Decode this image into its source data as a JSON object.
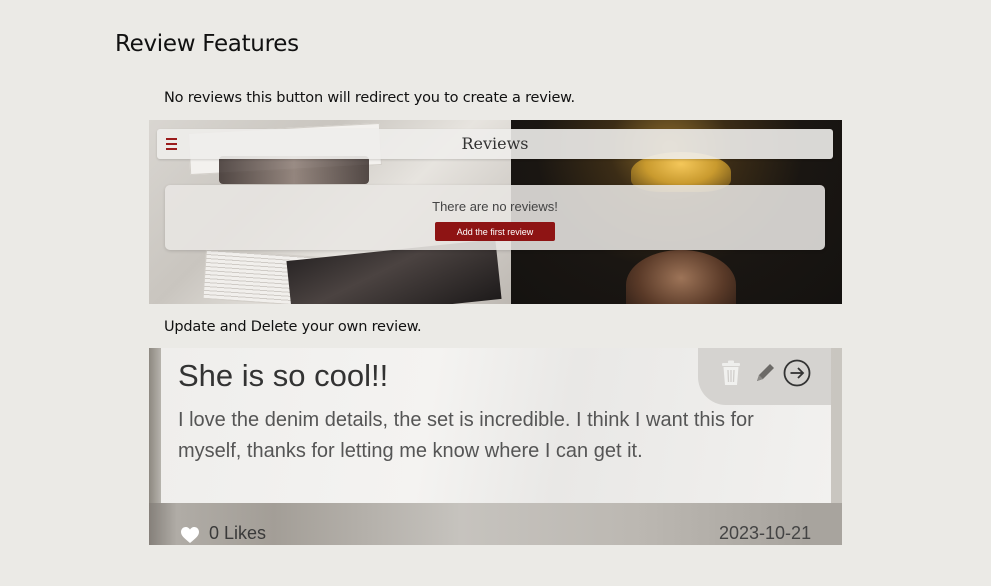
{
  "page": {
    "title": "Review Features",
    "caption_no_reviews": "No reviews this button will redirect you to create a review.",
    "caption_update_delete": "Update and Delete your own review."
  },
  "shot_empty": {
    "nav_title": "Reviews",
    "menu_icon": "hamburger-icon",
    "empty_message": "There are no reviews!",
    "add_button_label": "Add the first review",
    "accent_color": "#8e1414"
  },
  "shot_review": {
    "title": "She is so cool!!",
    "body": "I love the denim details, the set is incredible. I think I want this for myself, thanks for letting me know where I can get it.",
    "likes_count": "0",
    "likes_label": "0 Likes",
    "date": "2023-10-21",
    "icons": [
      "trash-icon",
      "pencil-icon",
      "arrow-right-circle-icon",
      "heart-icon"
    ]
  }
}
